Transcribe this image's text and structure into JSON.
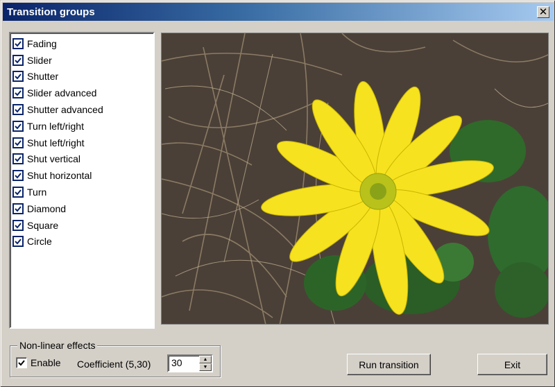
{
  "window": {
    "title": "Transition groups",
    "close_glyph": "✕"
  },
  "groups": [
    {
      "label": "Fading",
      "checked": true
    },
    {
      "label": "Slider",
      "checked": true
    },
    {
      "label": "Shutter",
      "checked": true
    },
    {
      "label": "Slider advanced",
      "checked": true
    },
    {
      "label": "Shutter advanced",
      "checked": true
    },
    {
      "label": "Turn left/right",
      "checked": true
    },
    {
      "label": "Shut left/right",
      "checked": true
    },
    {
      "label": "Shut vertical",
      "checked": true
    },
    {
      "label": "Shut horizontal",
      "checked": true
    },
    {
      "label": "Turn",
      "checked": true
    },
    {
      "label": "Diamond",
      "checked": true
    },
    {
      "label": "Square",
      "checked": true
    },
    {
      "label": "Circle",
      "checked": true
    }
  ],
  "nonlinear": {
    "legend": "Non-linear effects",
    "enable_label": "Enable",
    "enable_checked": true,
    "coefficient_label": "Coefficient (5,30)",
    "coefficient_value": "30"
  },
  "buttons": {
    "run": "Run transition",
    "exit": "Exit"
  },
  "icons": {
    "check": "checkmark-icon",
    "up": "spin-up-icon",
    "down": "spin-down-icon",
    "close": "close-icon"
  }
}
